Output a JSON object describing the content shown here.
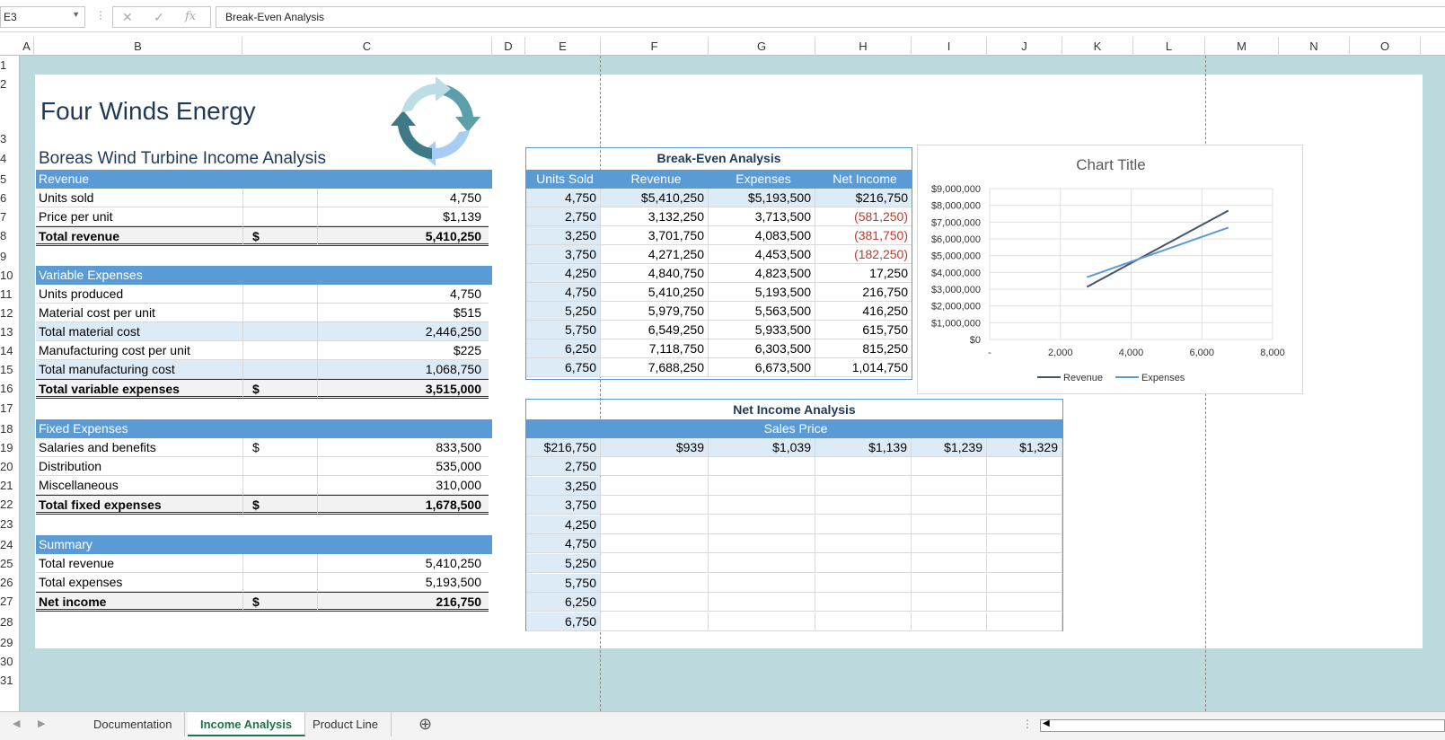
{
  "formula_bar": {
    "name_box": "E3",
    "formula": "Break-Even Analysis"
  },
  "columns": [
    "A",
    "B",
    "C",
    "D",
    "E",
    "F",
    "G",
    "H",
    "I",
    "J",
    "K",
    "L",
    "M",
    "N",
    "O"
  ],
  "rows": [
    "1",
    "2",
    "3",
    "4",
    "5",
    "6",
    "7",
    "8",
    "9",
    "10",
    "11",
    "12",
    "13",
    "14",
    "15",
    "16",
    "17",
    "18",
    "19",
    "20",
    "21",
    "22",
    "23",
    "24",
    "25",
    "26",
    "27",
    "28",
    "29",
    "30",
    "31"
  ],
  "sheet": {
    "title": "Four Winds Energy",
    "subtitle": "Boreas Wind Turbine Income Analysis",
    "revenue": {
      "header": "Revenue",
      "units_sold_label": "Units sold",
      "units_sold": "4,750",
      "price_label": "Price per unit",
      "price": "$1,139",
      "total_label": "Total revenue",
      "total_dollar": "$",
      "total": "5,410,250"
    },
    "variable": {
      "header": "Variable Expenses",
      "rows": [
        {
          "label": "Units produced",
          "value": "4,750"
        },
        {
          "label": "Material cost per unit",
          "value": "$515"
        },
        {
          "label": "Total material cost",
          "value": "2,446,250"
        },
        {
          "label": "Manufacturing cost per unit",
          "value": "$225"
        },
        {
          "label": "Total manufacturing cost",
          "value": "1,068,750"
        }
      ],
      "total_label": "Total variable expenses",
      "total_dollar": "$",
      "total": "3,515,000"
    },
    "fixed": {
      "header": "Fixed Expenses",
      "rows": [
        {
          "label": "Salaries and benefits",
          "dollar": "$",
          "value": "833,500"
        },
        {
          "label": "Distribution",
          "dollar": "",
          "value": "535,000"
        },
        {
          "label": "Miscellaneous",
          "dollar": "",
          "value": "310,000"
        }
      ],
      "total_label": "Total fixed expenses",
      "total_dollar": "$",
      "total": "1,678,500"
    },
    "summary": {
      "header": "Summary",
      "rows": [
        {
          "label": "Total revenue",
          "value": "5,410,250"
        },
        {
          "label": "Total expenses",
          "value": "5,193,500"
        }
      ],
      "total_label": "Net income",
      "total_dollar": "$",
      "total": "216,750"
    }
  },
  "break_even": {
    "title": "Break-Even Analysis",
    "headers": [
      "Units Sold",
      "Revenue",
      "Expenses",
      "Net Income"
    ],
    "rows": [
      [
        "4,750",
        "$5,410,250",
        "$5,193,500",
        "$216,750"
      ],
      [
        "2,750",
        "3,132,250",
        "3,713,500",
        "(581,250)"
      ],
      [
        "3,250",
        "3,701,750",
        "4,083,500",
        "(381,750)"
      ],
      [
        "3,750",
        "4,271,250",
        "4,453,500",
        "(182,250)"
      ],
      [
        "4,250",
        "4,840,750",
        "4,823,500",
        "17,250"
      ],
      [
        "4,750",
        "5,410,250",
        "5,193,500",
        "216,750"
      ],
      [
        "5,250",
        "5,979,750",
        "5,563,500",
        "416,250"
      ],
      [
        "5,750",
        "6,549,250",
        "5,933,500",
        "615,750"
      ],
      [
        "6,250",
        "7,118,750",
        "6,303,500",
        "815,250"
      ],
      [
        "6,750",
        "7,688,250",
        "6,673,500",
        "1,014,750"
      ]
    ]
  },
  "net_income": {
    "title": "Net Income Analysis",
    "sales_price_label": "Sales Price",
    "corner": "$216,750",
    "prices": [
      "$939",
      "$1,039",
      "$1,139",
      "$1,239",
      "$1,329"
    ],
    "units": [
      "2,750",
      "3,250",
      "3,750",
      "4,250",
      "4,750",
      "5,250",
      "5,750",
      "6,250",
      "6,750"
    ]
  },
  "chart_data": {
    "type": "line",
    "title": "Chart Title",
    "x_ticks": [
      "-",
      "2,000",
      "4,000",
      "6,000",
      "8,000"
    ],
    "y_ticks": [
      "$0",
      "$1,000,000",
      "$2,000,000",
      "$3,000,000",
      "$4,000,000",
      "$5,000,000",
      "$6,000,000",
      "$7,000,000",
      "$8,000,000",
      "$9,000,000"
    ],
    "xlim": [
      0,
      8000
    ],
    "ylim": [
      0,
      9000000
    ],
    "x": [
      2750,
      3250,
      3750,
      4250,
      4750,
      5250,
      5750,
      6250,
      6750
    ],
    "series": [
      {
        "name": "Revenue",
        "color": "#44546a",
        "values": [
          3132250,
          3701750,
          4271250,
          4840750,
          5410250,
          5979750,
          6549250,
          7118750,
          7688250
        ]
      },
      {
        "name": "Expenses",
        "color": "#5b9bd5",
        "values": [
          3713500,
          4083500,
          4453500,
          4823500,
          5193500,
          5563500,
          5933500,
          6303500,
          6673500
        ]
      }
    ],
    "legend_position": "bottom"
  },
  "tabs": [
    "Documentation",
    "Income Analysis",
    "Product Line"
  ],
  "active_tab": "Income Analysis",
  "icons": {
    "add_sheet": "plus-circle-icon",
    "nav_prev": "caret-left-icon",
    "nav_next": "caret-right-icon"
  }
}
